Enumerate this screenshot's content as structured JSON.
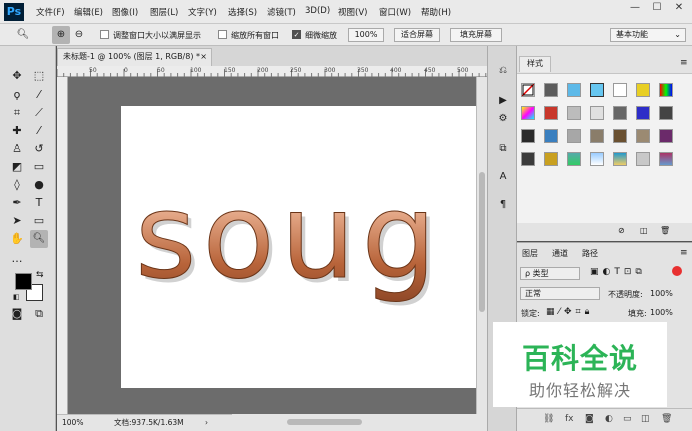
{
  "app": {
    "logo": "Ps"
  },
  "menu": [
    "文件(F)",
    "编辑(E)",
    "图像(I)",
    "图层(L)",
    "文字(Y)",
    "选择(S)",
    "滤镜(T)",
    "3D(D)",
    "视图(V)",
    "窗口(W)",
    "帮助(H)"
  ],
  "options": {
    "resize_windows": "调整窗口大小以满屏显示",
    "zoom_all": "缩放所有窗口",
    "scrubby_zoom": "细微缩放",
    "zoom_value": "100%",
    "fit_screen": "适合屏幕",
    "fill_screen": "填充屏幕",
    "workspace": "基本功能"
  },
  "document": {
    "tab_title": "未标题-1 @ 100% (图层 1, RGB/8) *",
    "canvas_text": "soug",
    "status_zoom": "100%",
    "status_doc": "文档:937.5K/1.63M"
  },
  "ruler_ticks": [
    "50",
    "0",
    "50",
    "100",
    "150",
    "200",
    "250",
    "300",
    "350",
    "400",
    "450",
    "500"
  ],
  "styles": {
    "tab": "样式"
  },
  "layers": {
    "tabs": [
      "图层",
      "通道",
      "路径"
    ],
    "kind": "ρ 类型",
    "blend": "正常",
    "opacity_label": "不透明度:",
    "opacity_value": "100%",
    "lock_label": "锁定:",
    "fill_label": "填充:",
    "fill_value": "100%"
  },
  "watermark": {
    "title": "百科全说",
    "subtitle": "助你轻松解决"
  },
  "colors": {
    "accent_green": "#2cb457",
    "ps_blue": "#31a8ff"
  }
}
